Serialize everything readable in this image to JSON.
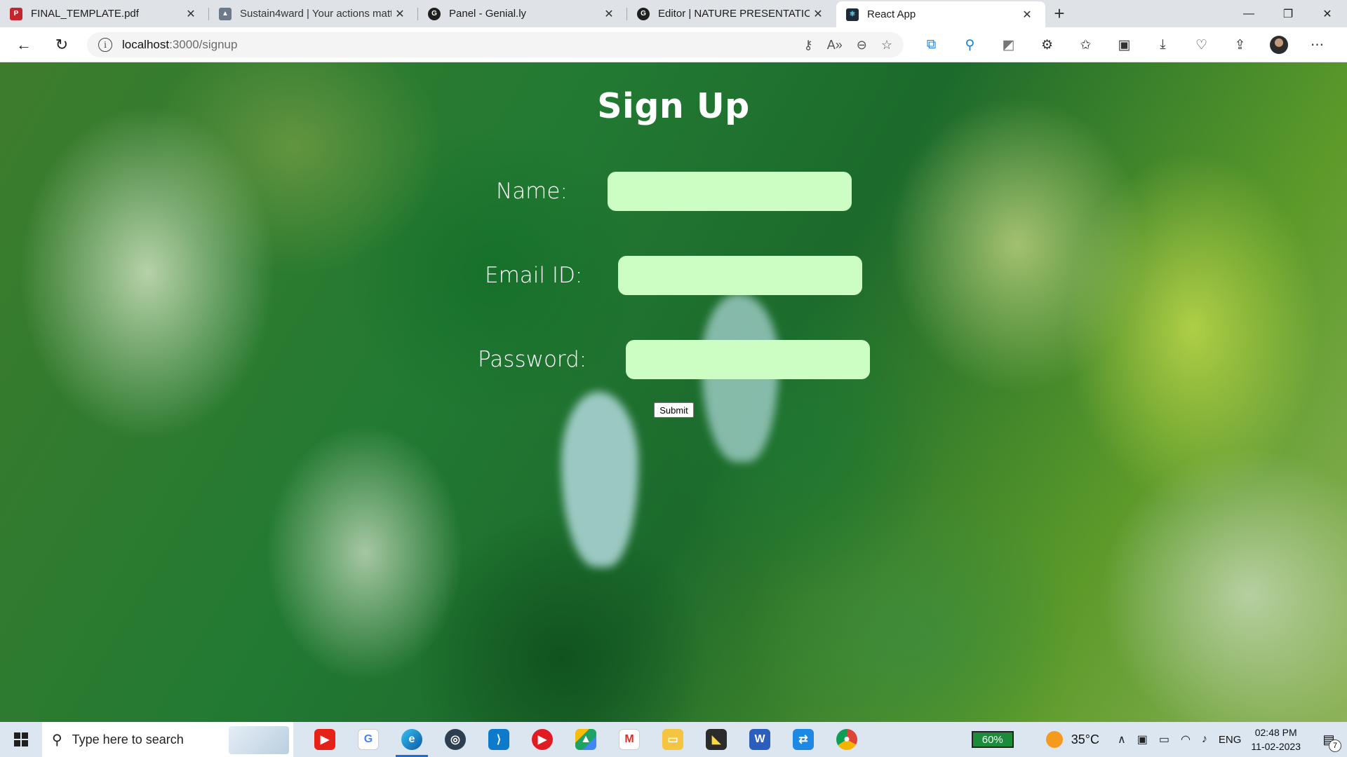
{
  "browser": {
    "tabs": [
      {
        "label": "FINAL_TEMPLATE.pdf",
        "icon": "pdf-icon",
        "color": "#c4262e"
      },
      {
        "label": "Sustain4ward | Your actions matt",
        "icon": "image-icon",
        "color": "#6c7a89"
      },
      {
        "label": "Panel - Genial.ly",
        "icon": "genially-icon",
        "color": "#1e1e1e"
      },
      {
        "label": "Editor | NATURE PRESENTATION",
        "icon": "genially-icon",
        "color": "#1e1e1e"
      },
      {
        "label": "React App",
        "icon": "react-icon",
        "color": "#1e2a38"
      }
    ],
    "active_tab": 4,
    "address": {
      "host": "localhost",
      "path": ":3000/signup"
    }
  },
  "page": {
    "title": "Sign Up",
    "fields": [
      {
        "label": "Name:",
        "value": ""
      },
      {
        "label": "Email ID:",
        "value": ""
      },
      {
        "label": "Password:",
        "value": ""
      }
    ],
    "submit_label": "Submit",
    "input_color": "#ccfdc2"
  },
  "taskbar": {
    "search_placeholder": "Type here to search",
    "battery": "60%",
    "temperature": "35°C",
    "language": "ENG",
    "time": "02:48 PM",
    "date": "11-02-2023",
    "notifications": "7"
  }
}
